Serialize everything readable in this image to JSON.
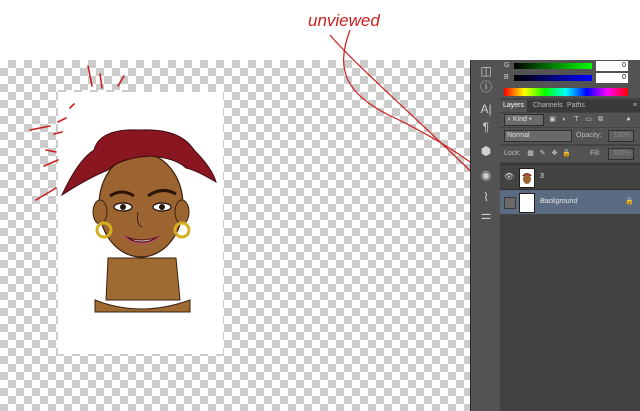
{
  "annotation": {
    "text": "unviewed",
    "color": "#cc1f1f"
  },
  "color_panel": {
    "rows": [
      {
        "channel": "G",
        "value": "0",
        "gradient_end": "#00ff00"
      },
      {
        "channel": "B",
        "value": "0",
        "gradient_end": "#0000ff"
      }
    ]
  },
  "layers_panel": {
    "tabs": [
      {
        "label": "Layers",
        "active": true
      },
      {
        "label": "Channels",
        "active": false
      },
      {
        "label": "Paths",
        "active": false
      }
    ],
    "menu_icon": "≡",
    "filter": {
      "kind_label": "Kind"
    },
    "blend_mode": "Normal",
    "opacity": {
      "label": "Opacity:",
      "value": "100%"
    },
    "lock": {
      "label": "Lock:"
    },
    "fill": {
      "label": "Fill:",
      "value": "100%"
    },
    "layers": [
      {
        "name": "3",
        "visible": true,
        "selected": false,
        "locked": false
      },
      {
        "name": "Background",
        "visible": false,
        "selected": true,
        "locked": true
      }
    ]
  },
  "colors": {
    "panel_bg": "#434343",
    "toolbar_bg": "#535353",
    "selected_layer": "#5b6b82",
    "accent_red": "#cc1f1f"
  },
  "icons": [
    "navigator-icon",
    "info-icon",
    "character-icon",
    "paragraph-icon",
    "3d-box-icon",
    "color-wheel-icon",
    "brush-icon",
    "sliders-icon"
  ]
}
